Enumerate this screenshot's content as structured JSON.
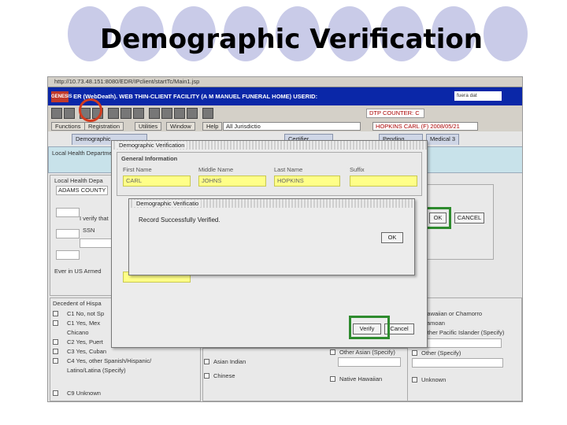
{
  "slide": {
    "title": "Demographic Verification"
  },
  "browser": {
    "address": "http://10.73.48.151:8080/EDR/IPclient/startTc/Main1.jsp"
  },
  "app": {
    "logo": "GENESIS",
    "title": "ER (WebDeath). WEB THIN-CLIENT FACILITY (A M MANUEL FUNERAL HOME) USERID:",
    "userid": "fuera dat"
  },
  "toolbar": {
    "dtp_counter": "DTP COUNTER: C"
  },
  "menus": [
    "Functions",
    "Registration",
    "Utilities",
    "Window",
    "Help"
  ],
  "menu_path": "All Jurisdictio",
  "selected_record": "HOPKINS CARL (F) 2008/05/21",
  "tabs": [
    "Demographic",
    "Demographic Verification",
    "Certifier",
    "Pending",
    "Medical 3"
  ],
  "background": {
    "section_title": "Local Health Department",
    "local_health_label": "Local Health Depa",
    "local_health_value": "ADAMS COUNTY",
    "armed_forces": "Ever in US Armed",
    "hispanic_title": "Decedent of Hispa",
    "hispanic_options": [
      "C1 No, not Sp",
      "C1 Yes, Mex",
      "Chicano",
      "C2 Yes, Puert",
      "C3 Yes, Cuban",
      "C4 Yes, other Spanish/Hispanic/",
      "Latino/Latina (Specify)",
      "C9 Unknown"
    ],
    "race_options_mid": [
      "Asian Indian",
      "Chinese"
    ],
    "race_options_mid2": [
      "Other Asian (Specify)",
      "Native Hawaiian"
    ],
    "race_options_right": [
      "Hawaiian or Chamorro",
      "Samoan",
      "Other Pacific Islander (Specify)",
      "Other (Specify)",
      "Unknown"
    ],
    "verify_prompt": "I verify that",
    "ssn_label": "SSN",
    "ok_label": "OK",
    "cancel_label": "CANCEL"
  },
  "verification_dialog": {
    "title": "Demographic Verification",
    "section": "General Information",
    "fields": [
      {
        "label": "First Name",
        "value": "CARL"
      },
      {
        "label": "Middle Name",
        "value": "JOHNS"
      },
      {
        "label": "Last Name",
        "value": "HOPKINS"
      },
      {
        "label": "Suffix",
        "value": ""
      }
    ],
    "verify_label": "Verify",
    "cancel_label": "Cancel"
  },
  "message_dialog": {
    "title": "Demographic Verificatio",
    "message": "Record Successfully Verified.",
    "ok_label": "OK"
  },
  "colors": {
    "app_bar": "#0a27a8",
    "highlight_field": "#ffff88",
    "annotation_green": "#2e8b2e",
    "annotation_red": "#d33c1e",
    "slide_circle": "#c9cbe8"
  }
}
